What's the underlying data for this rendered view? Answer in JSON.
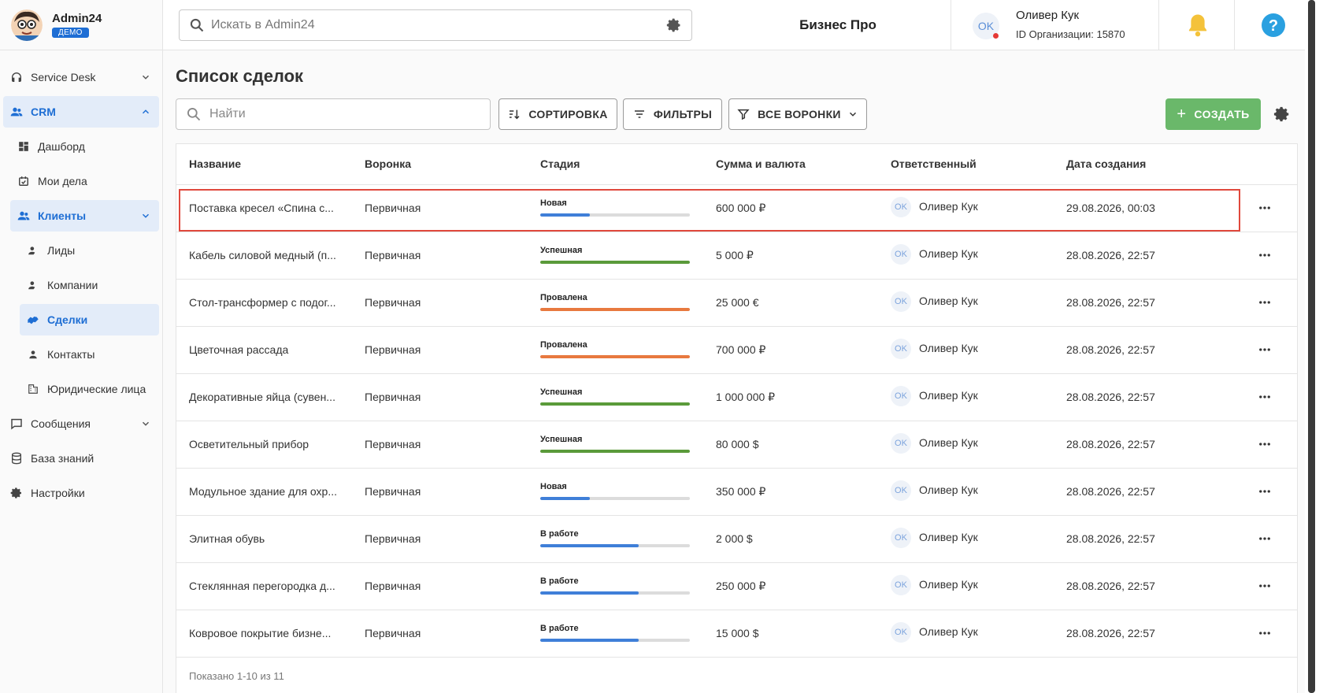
{
  "app": {
    "name": "Admin24",
    "badge": "ДЕМО"
  },
  "sidebar": {
    "items": [
      {
        "label": "Service Desk",
        "icon": "headset-icon"
      },
      {
        "label": "CRM",
        "icon": "users-icon"
      },
      {
        "label": "Дашборд",
        "icon": "dashboard-icon"
      },
      {
        "label": "Мои дела",
        "icon": "calendar-check-icon"
      },
      {
        "label": "Клиенты",
        "icon": "users-icon"
      },
      {
        "label": "Лиды",
        "icon": "person-icon"
      },
      {
        "label": "Компании",
        "icon": "person-icon"
      },
      {
        "label": "Сделки",
        "icon": "handshake-icon"
      },
      {
        "label": "Контакты",
        "icon": "person-icon"
      },
      {
        "label": "Юридические лица",
        "icon": "building-icon"
      },
      {
        "label": "Сообщения",
        "icon": "message-icon"
      },
      {
        "label": "База знаний",
        "icon": "database-icon"
      },
      {
        "label": "Настройки",
        "icon": "gear-icon"
      }
    ]
  },
  "header": {
    "search_placeholder": "Искать в Admin24",
    "plan": "Бизнес Про",
    "user_initials": "OK",
    "user_name": "Оливер Кук",
    "org_id": "ID Организации: 15870"
  },
  "main": {
    "title": "Список сделок",
    "find_placeholder": "Найти",
    "sort_label": "СОРТИРОВКА",
    "filter_label": "ФИЛЬТРЫ",
    "funnels_label": "ВСЕ ВОРОНКИ",
    "create_label": "СОЗДАТЬ",
    "columns": [
      "Название",
      "Воронка",
      "Стадия",
      "Сумма и валюта",
      "Ответственный",
      "Дата создания"
    ],
    "rows": [
      {
        "name": "Поставка кресел «Спина с...",
        "funnel": "Первичная",
        "stage": "Новая",
        "progress": 0.33,
        "color": "#3f7fd8",
        "amount": "600 000 ₽",
        "owner": "Оливер Кук",
        "date": "29.08.2026, 00:03"
      },
      {
        "name": "Кабель силовой медный (п...",
        "funnel": "Первичная",
        "stage": "Успешная",
        "progress": 1.0,
        "color": "#5a9a3a",
        "amount": "5 000 ₽",
        "owner": "Оливер Кук",
        "date": "28.08.2026, 22:57"
      },
      {
        "name": "Стол-трансформер с подог...",
        "funnel": "Первичная",
        "stage": "Провалена",
        "progress": 1.0,
        "color": "#e8793f",
        "amount": "25 000 €",
        "owner": "Оливер Кук",
        "date": "28.08.2026, 22:57"
      },
      {
        "name": "Цветочная рассада",
        "funnel": "Первичная",
        "stage": "Провалена",
        "progress": 1.0,
        "color": "#e8793f",
        "amount": "700 000 ₽",
        "owner": "Оливер Кук",
        "date": "28.08.2026, 22:57"
      },
      {
        "name": "Декоративные яйца (сувен...",
        "funnel": "Первичная",
        "stage": "Успешная",
        "progress": 1.0,
        "color": "#5a9a3a",
        "amount": "1 000 000 ₽",
        "owner": "Оливер Кук",
        "date": "28.08.2026, 22:57"
      },
      {
        "name": "Осветительный прибор",
        "funnel": "Первичная",
        "stage": "Успешная",
        "progress": 1.0,
        "color": "#5a9a3a",
        "amount": "80 000 $",
        "owner": "Оливер Кук",
        "date": "28.08.2026, 22:57"
      },
      {
        "name": "Модульное здание для охр...",
        "funnel": "Первичная",
        "stage": "Новая",
        "progress": 0.33,
        "color": "#3f7fd8",
        "amount": "350 000 ₽",
        "owner": "Оливер Кук",
        "date": "28.08.2026, 22:57"
      },
      {
        "name": "Элитная обувь",
        "funnel": "Первичная",
        "stage": "В работе",
        "progress": 0.66,
        "color": "#3f7fd8",
        "amount": "2 000 $",
        "owner": "Оливер Кук",
        "date": "28.08.2026, 22:57"
      },
      {
        "name": "Стеклянная перегородка д...",
        "funnel": "Первичная",
        "stage": "В работе",
        "progress": 0.66,
        "color": "#3f7fd8",
        "amount": "250 000 ₽",
        "owner": "Оливер Кук",
        "date": "28.08.2026, 22:57"
      },
      {
        "name": "Ковровое покрытие бизне...",
        "funnel": "Первичная",
        "stage": "В работе",
        "progress": 0.66,
        "color": "#3f7fd8",
        "amount": "15 000 $",
        "owner": "Оливер Кук",
        "date": "28.08.2026, 22:57"
      }
    ],
    "row_initials": "OK",
    "footer": "Показано 1-10 из 11"
  },
  "colors": {
    "accent": "#1e6ed4",
    "create": "#6ab86a",
    "highlight": "#e0483c"
  }
}
